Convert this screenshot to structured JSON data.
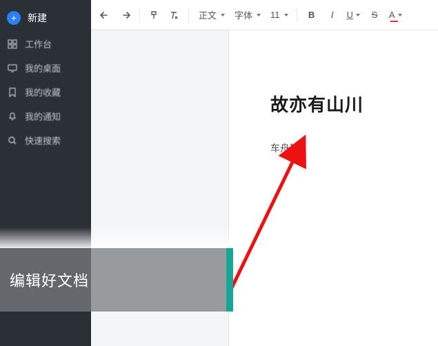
{
  "sidebar": {
    "new_label": "新建",
    "items": [
      {
        "label": "工作台",
        "icon": "grid"
      },
      {
        "label": "我的桌面",
        "icon": "desktop"
      },
      {
        "label": "我的收藏",
        "icon": "bookmark"
      },
      {
        "label": "我的通知",
        "icon": "bell"
      },
      {
        "label": "快速搜索",
        "icon": "search"
      }
    ]
  },
  "toolbar": {
    "style_label": "正文",
    "font_label": "字体",
    "font_size": "11",
    "bold": "B",
    "italic": "I",
    "underline": "U",
    "strike": "S",
    "color": "A"
  },
  "document": {
    "title": "故亦有山川",
    "body": "车舟辑"
  },
  "caption": {
    "text": "编辑好文档"
  }
}
